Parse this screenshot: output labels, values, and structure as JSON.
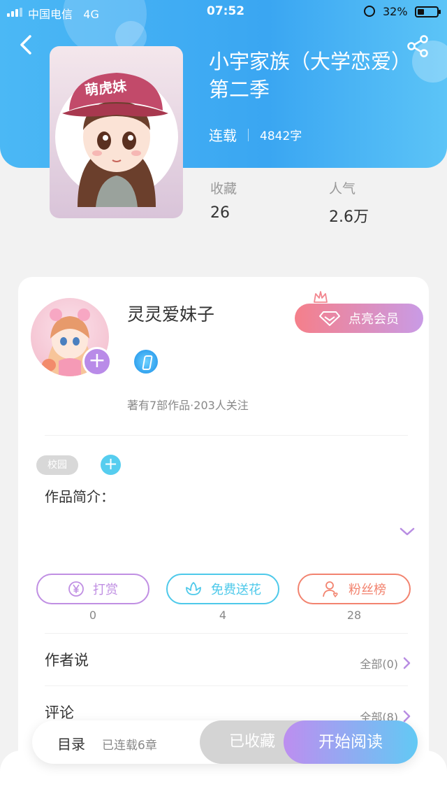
{
  "status_bar": {
    "carrier": "中国电信",
    "network": "4G",
    "time": "07:52",
    "battery": "32%"
  },
  "book": {
    "title": "小宇家族（大学恋爱）第二季",
    "cover_text": "萌虎妹",
    "status": "连载",
    "word_count": "4842字",
    "stats": [
      {
        "label": "收藏",
        "value": "26"
      },
      {
        "label": "人气",
        "value": "2.6万"
      }
    ]
  },
  "author": {
    "name": "灵灵爱妹子",
    "stats_line": "著有7部作品·203人关注",
    "vip_label": "点亮会员"
  },
  "tags": [
    "校园"
  ],
  "intro_label": "作品简介：",
  "actions": [
    {
      "label": "打赏",
      "count": "0",
      "icon": "yen-coin-icon",
      "color": "#c08fe3"
    },
    {
      "label": "免费送花",
      "count": "4",
      "icon": "flower-icon",
      "color": "#4ec9ea"
    },
    {
      "label": "粉丝榜",
      "count": "28",
      "icon": "fans-person-icon",
      "color": "#f2836f"
    }
  ],
  "sections": {
    "author_says": {
      "label": "作者说",
      "link": "全部(0)"
    },
    "comments": {
      "label": "评论",
      "link": "全部(8)"
    }
  },
  "bottom_bar": {
    "toc_label": "目录",
    "toc_sub": "已连载6章",
    "favorited_label": "已收藏",
    "read_label": "开始阅读"
  }
}
